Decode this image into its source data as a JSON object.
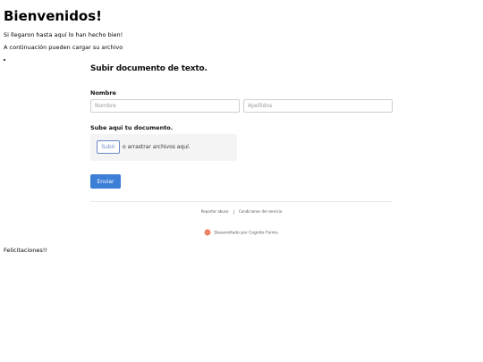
{
  "page": {
    "heading": "Bienvenidos!",
    "intro_line1": "Si llegaron hasta aquí lo han hecho bien!",
    "intro_line2": "A continuación pueden cargar su archivo",
    "closing": "Felicitaciones!!"
  },
  "form": {
    "title": "Subir documento de texto.",
    "name_label": "Nombre",
    "first_name_placeholder": "Nombre",
    "last_name_placeholder": "Apellidos",
    "upload_label": "Sube aqui tu documento.",
    "upload_button": "Subir",
    "upload_hint": "o arrastrar archivos aquí.",
    "submit_button": "Enviar"
  },
  "footer": {
    "report_link": "Reportar abuso",
    "terms_link": "Condiciones del servicio",
    "powered_by": "Desarrollado por Cognito Forms."
  },
  "colors": {
    "accent": "#3d7fd7",
    "brand_icon": "#e8532d"
  },
  "icons": {
    "brand": "cognito-forms-logo-icon"
  }
}
